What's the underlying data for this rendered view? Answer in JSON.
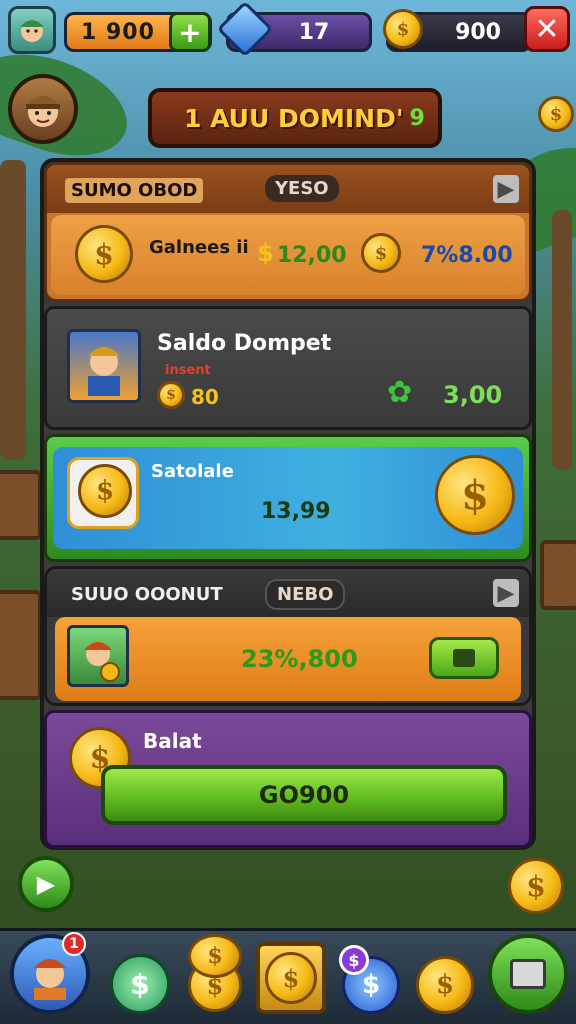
{
  "hud": {
    "money_value": "1   900",
    "plus_label": "+",
    "gems_value": "17",
    "coins_value": "900",
    "close_label": "✕"
  },
  "title": {
    "text": "1  AUU DOMIND'",
    "leaf_glyph": "9"
  },
  "section1": {
    "header_label": "SUMO OBOD",
    "chip_label": "YESO",
    "arrow_glyph": "▶",
    "row_label": "Galnees ii",
    "value_a": "12,00",
    "value_b": "7%8.00"
  },
  "section2": {
    "title": "Saldo Dompet",
    "subtitle": "insent",
    "coin_value": "80",
    "value": "3,00"
  },
  "section3": {
    "label": "Satolale",
    "value": "13,99"
  },
  "section4": {
    "header_label": "SUUO OOONUT",
    "chip_label": "NEBO",
    "arrow_glyph": "▶",
    "value": "23%,800"
  },
  "section5": {
    "label": "Balat",
    "button_label": "GO900"
  },
  "bottom_bar": {
    "profile_badge": "1",
    "dollar_glyph": "$",
    "mini_badge": "$"
  },
  "icons": {
    "coin_glyph": "$",
    "side_glyph": "▶"
  },
  "colors": {
    "gold": "#f5b916",
    "green": "#5cb81e",
    "orange": "#e07c18",
    "purple": "#5a2f7a"
  }
}
